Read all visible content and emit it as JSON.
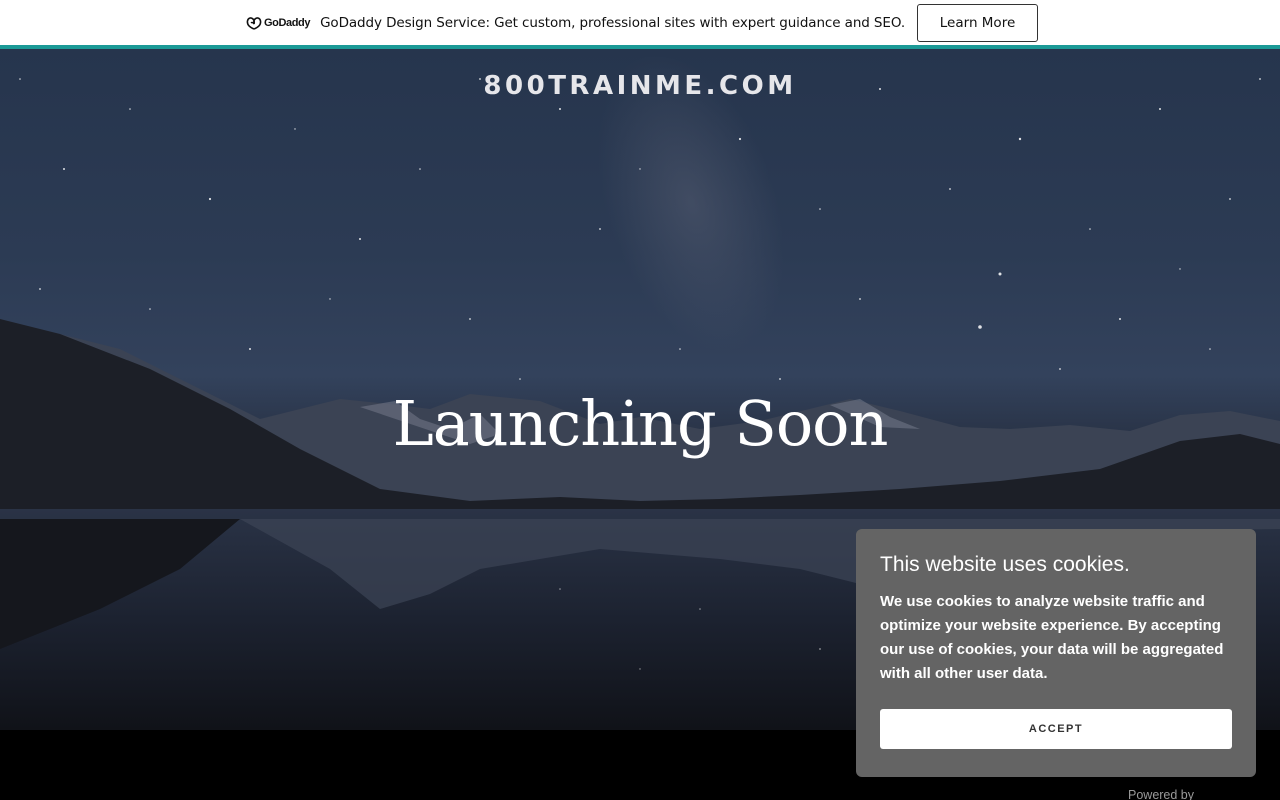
{
  "promo": {
    "logo_text": "GoDaddy",
    "message": "GoDaddy Design Service: Get custom, professional sites with expert guidance and SEO.",
    "button_label": "Learn More",
    "accent_color": "#1b9a97"
  },
  "hero": {
    "site_name": "800TRAINME.COM",
    "headline": "Launching Soon"
  },
  "cookie": {
    "title": "This website uses cookies.",
    "body": "We use cookies to analyze website traffic and optimize your website experience. By accepting our use of cookies, your data will be aggregated with all other user data.",
    "accept_label": "ACCEPT"
  },
  "footer": {
    "powered_by": "Powered by"
  }
}
